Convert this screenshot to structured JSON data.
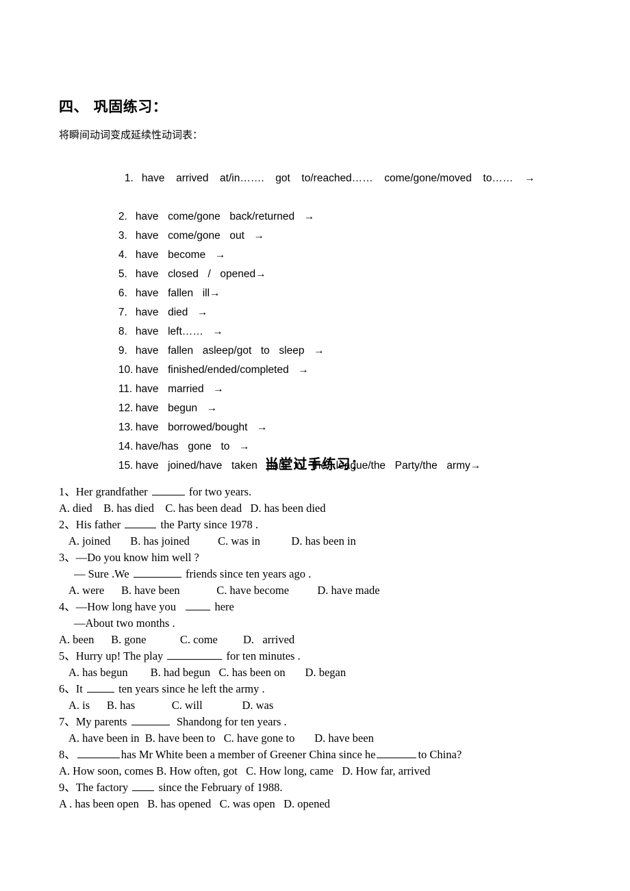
{
  "document": {
    "section_heading": "四、 巩固练习：",
    "subtitle": "将瞬间动词变成延续性动词表：",
    "quiz_heading": "当堂过手练习："
  },
  "verb_list": [
    {
      "num": "1.",
      "text": "have  arrived  at/in…….  got  to/reached……  come/gone/moved  to……  →"
    },
    {
      "num": "2.",
      "text": "have  come/gone  back/returned  →"
    },
    {
      "num": "3.",
      "text": "have  come/gone  out  →"
    },
    {
      "num": "4.",
      "text": "have  become  →"
    },
    {
      "num": "5.",
      "text": "have  closed  /  opened→"
    },
    {
      "num": "6.",
      "text": "have  fallen  ill→"
    },
    {
      "num": "7.",
      "text": "have  died  →"
    },
    {
      "num": "8.",
      "text": "have  left……  →"
    },
    {
      "num": "9.",
      "text": "have  fallen  asleep/got  to  sleep  →"
    },
    {
      "num": "10.",
      "text": "have  finished/ended/completed  →"
    },
    {
      "num": "11.",
      "text": "have  married  →"
    },
    {
      "num": "12.",
      "text": "have  begun  →"
    },
    {
      "num": "13.",
      "text": "have  borrowed/bought  →"
    },
    {
      "num": "14.",
      "text": "have/has  gone  to  →"
    },
    {
      "num": "15.",
      "text": "have  joined/have  taken  part  in  the  league/the  Party/the  army→"
    }
  ],
  "quiz": {
    "q1": {
      "stem_a": "1、Her grandfather ",
      "stem_b": " for two years.",
      "options": "A. died    B. has died    C. has been dead   D. has been died"
    },
    "q2": {
      "stem_a": "2、His father ",
      "stem_b": " the Party since 1978 .",
      "options": "A. joined       B. has joined          C. was in           D. has been in"
    },
    "q3": {
      "line1": "3、—Do you know him well ?",
      "line2_a": "— Sure .We ",
      "line2_b": " friends since ten years ago .",
      "options": "A. were      B. have been             C. have become          D. have made"
    },
    "q4": {
      "line1_a": "4、—How long have you   ",
      "line1_b": " here",
      "line2": "—About two months .",
      "options": "A. been      B. gone            C. come         D.   arrived"
    },
    "q5": {
      "stem_a": "5、Hurry up! The play ",
      "stem_b": " for ten minutes .",
      "options": "A. has begun        B. had begun   C. has been on       D. began"
    },
    "q6": {
      "stem_a": "6、It ",
      "stem_b": " ten years since he left the army .",
      "options": "A. is      B. has             C. will              D. was"
    },
    "q7": {
      "stem_a": "7、My parents ",
      "stem_b": "  Shandong for ten years .",
      "options": "A. have been in  B. have been to   C. have gone to       D. have been"
    },
    "q8": {
      "stem_a": "8、",
      "stem_b": "has Mr White been a member of Greener China since he",
      "stem_c": "to China?",
      "options": "A. How soon, comes B. How often, got   C. How long, came   D. How far, arrived"
    },
    "q9": {
      "stem_a": "9、The factory ",
      "stem_b": " since the February of 1988.",
      "options": "A . has been open   B. has opened   C. was open   D. opened"
    }
  }
}
